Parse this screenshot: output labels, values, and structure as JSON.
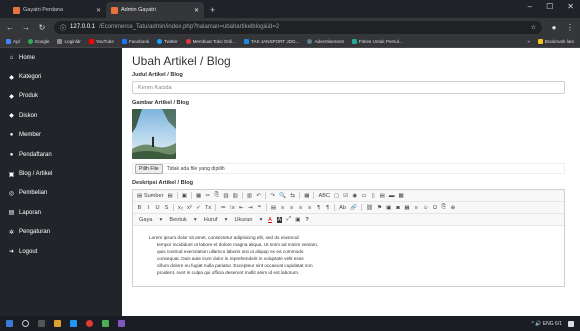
{
  "browser": {
    "tabs": [
      {
        "title": "Gayatri Perdana",
        "active": false
      },
      {
        "title": "Admin Gayatri",
        "active": true
      }
    ],
    "new_tab_icon": "plus-icon",
    "url_host": "127.0.0.1",
    "url_path": "/Ecommerce_Tatu/admin/index.php?halaman=ubahartikelblog&id=2",
    "bookmarks": [
      {
        "label": "Apl",
        "color": "#4285f4"
      },
      {
        "label": "Google",
        "color": "#34a853"
      },
      {
        "label": "Loginldr",
        "color": "#888888"
      },
      {
        "label": "YouTube",
        "color": "#ff0000"
      },
      {
        "label": "Facebook",
        "color": "#1877f2"
      },
      {
        "label": "Twitter",
        "color": "#1da1f2"
      },
      {
        "label": "Membuat Toko Onli...",
        "color": "#e53935"
      },
      {
        "label": "TAS JANSPORT JDG...",
        "color": "#1e88e5"
      },
      {
        "label": "Advertisement",
        "color": "#607d8b"
      },
      {
        "label": "Fitnes Untuk Pemul...",
        "color": "#26a69a"
      }
    ],
    "bookmarks_right": "Bookmark lain"
  },
  "sidebar": {
    "items": [
      {
        "label": "Home",
        "icon": "home-icon",
        "glyph": "⌂"
      },
      {
        "label": "Kategori",
        "icon": "tag-icon",
        "glyph": "◆"
      },
      {
        "label": "Produk",
        "icon": "tag-icon",
        "glyph": "◆"
      },
      {
        "label": "Diskon",
        "icon": "tag-icon",
        "glyph": "◆"
      },
      {
        "label": "Member",
        "icon": "user-icon",
        "glyph": "●"
      },
      {
        "label": "Pendaftaran",
        "icon": "user-icon",
        "glyph": "●"
      },
      {
        "label": "Blog / Artikel",
        "icon": "image-icon",
        "glyph": "▣"
      },
      {
        "label": "Pembelian",
        "icon": "globe-icon",
        "glyph": "◎"
      },
      {
        "label": "Laporan",
        "icon": "print-icon",
        "glyph": "▤"
      },
      {
        "label": "Pengaturan",
        "icon": "gear-icon",
        "glyph": "✲"
      },
      {
        "label": "Logout",
        "icon": "logout-icon",
        "glyph": "➜"
      }
    ]
  },
  "main": {
    "title": "Ubah Artikel / Blog",
    "judul_label": "Judul Artikel / Blog",
    "judul_value": "Keren Kacida",
    "gambar_label": "Gambar Artikel / Blog",
    "file_button": "Pilih File",
    "file_text": "Tidak ada file yang dipilih",
    "deskripsi_label": "Deskripsi Artikel / Blog",
    "toolbar_row1": [
      "Sumber",
      "Pratinjau",
      "Templat",
      "Potong",
      "Salin",
      "Tempel",
      "Tempel Teks",
      "Tempel Word",
      "Batal",
      "Ulangi",
      "Temukan",
      "Ganti",
      "Pilih Semua",
      "Periksa Ejaan",
      "Formulir",
      "Kotak Centang",
      "Tombol Radio",
      "Bidang Teks",
      "Area Teks",
      "Seleksi",
      "Tombol",
      "Tombol Gambar",
      "Bidang Tersembunyi"
    ],
    "toolbar_row2": [
      "B",
      "I",
      "U",
      "S",
      "x₂",
      "x²",
      "✓",
      "Tx",
      "≔",
      "⁝≡",
      "⇤",
      "⇥",
      "❝",
      "▤",
      "≡",
      "≡",
      "≡",
      "≡",
      "¶",
      "¶",
      "Ab",
      "🔗",
      "⛓",
      "⚑",
      "▣",
      "◙",
      "▦",
      "≡",
      "☺",
      "Ω",
      "⎘",
      "⊕"
    ],
    "style_select": "Gaya",
    "format_select": "Bentuk",
    "font_select": "Huruf",
    "size_select": "Ukuran",
    "toolbar_row3_extra": [
      "A",
      "A",
      "⤢",
      "▣",
      "?"
    ],
    "editor_lines": [
      "Lorem ipsum dolor sit amet, consectetur adipisicing elit, sed do eiusmod",
      "tempor incididunt ut labore et dolore magna aliqua. Ut enim ad minim veniam,",
      "quis nostrud exercitation ullamco laboris nisi ut aliquip ex ea commodo",
      "consequat. Duis aute irure dolor in reprehenderit in voluptate velit esse",
      "cillum dolore eu fugiat nulla pariatur. Excepteur sint occaecat cupidatat non",
      "proident, sunt in culpa qui officia deserunt mollit anim id est laborum."
    ]
  },
  "taskbar": {
    "tray_text": "^ 🔊 ENG 6/1",
    "icons": [
      "#3a7bd5",
      "#e0a030",
      "#4caf50",
      "#2196f3",
      "#e53935",
      "#f0c419",
      "#7e57c2"
    ]
  }
}
